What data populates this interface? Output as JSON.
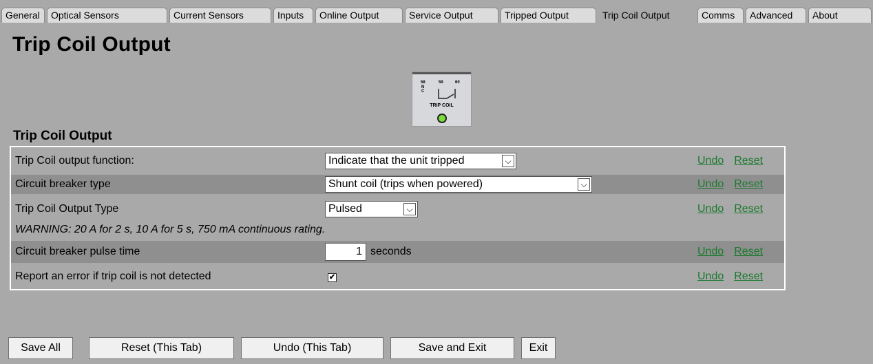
{
  "tabs": [
    {
      "label": "General"
    },
    {
      "label": "Optical Sensors"
    },
    {
      "label": "Current Sensors"
    },
    {
      "label": "Inputs"
    },
    {
      "label": "Online Output"
    },
    {
      "label": "Service Output"
    },
    {
      "label": "Tripped Output"
    },
    {
      "label": "Trip Coil Output"
    },
    {
      "label": "Comms"
    },
    {
      "label": "Advanced"
    },
    {
      "label": "About"
    }
  ],
  "active_tab": "Trip Coil Output",
  "page_title": "Trip Coil Output",
  "relay_image": {
    "pins": [
      "58",
      "59",
      "60"
    ],
    "pin_sub": [
      "N",
      "C"
    ],
    "caption": "TRIP COIL",
    "led_color": "#7ddc3c"
  },
  "section_title": "Trip Coil Output",
  "settings": {
    "function": {
      "label": "Trip Coil output function:",
      "value": "Indicate that the unit tripped"
    },
    "breaker_type": {
      "label": "Circuit breaker type",
      "value": "Shunt coil (trips when powered)"
    },
    "output_type": {
      "label": "Trip Coil Output Type",
      "value": "Pulsed"
    },
    "warning": "WARNING: 20 A for 2 s, 10 A for 5 s, 750 mA continuous rating.",
    "pulse_time": {
      "label": "Circuit breaker pulse time",
      "value": "1",
      "unit": "seconds"
    },
    "report_error": {
      "label": "Report an error if trip coil is not detected",
      "checked": true,
      "check_glyph": "✔"
    }
  },
  "links": {
    "undo": "Undo",
    "reset": "Reset"
  },
  "buttons": {
    "save_all": "Save All",
    "reset_tab": "Reset (This Tab)",
    "undo_tab": "Undo (This Tab)",
    "save_exit": "Save and Exit",
    "exit": "Exit"
  },
  "colors": {
    "background": "#a9a9a9",
    "link": "#1a7a2e",
    "row_alt": "#8f8f8f"
  }
}
